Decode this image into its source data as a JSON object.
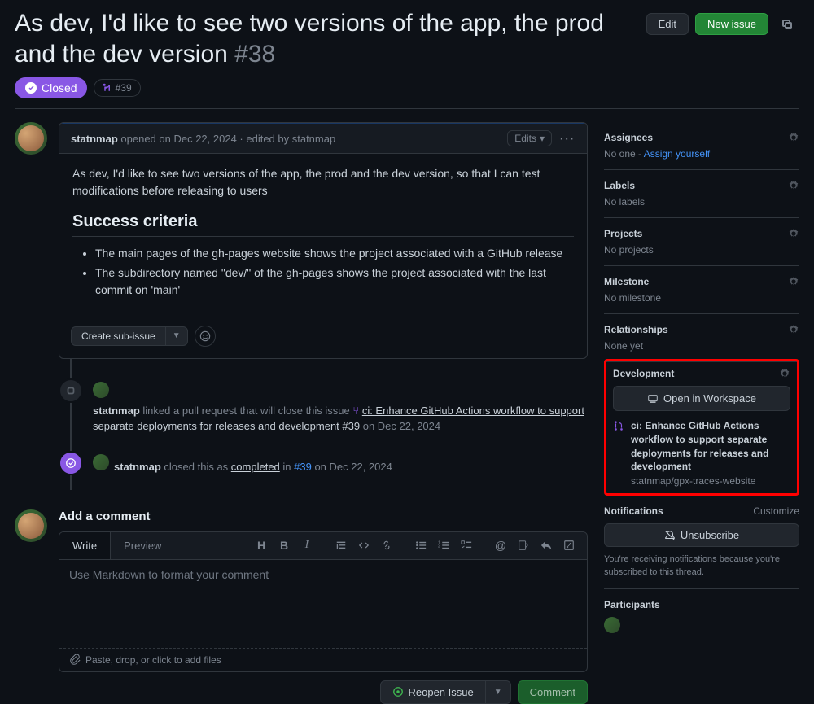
{
  "title": "As dev, I'd like to see two versions of the app, the prod and the dev version",
  "issue_number": "#38",
  "header_buttons": {
    "edit": "Edit",
    "new_issue": "New issue"
  },
  "status": {
    "label": "Closed",
    "linked_pr": "#39"
  },
  "comment": {
    "author": "statnmap",
    "meta": " opened on Dec 22, 2024 · edited by statnmap",
    "edits_label": "Edits",
    "body_text": "As dev, I'd like to see two versions of the app, the prod and the dev version, so that I can test modifications before releasing to users",
    "success_heading": "Success criteria",
    "criteria": [
      "The main pages of the gh-pages website shows the project associated with a GitHub release",
      "The subdirectory named \"dev/\" of the gh-pages shows the project associated with the last commit on 'main'"
    ],
    "sub_issue_btn": "Create sub-issue"
  },
  "timeline": {
    "link_event": {
      "author": "statnmap",
      "action": " linked a pull request that will close this issue ",
      "pr_title": "ci: Enhance GitHub Actions workflow to support separate deployments for releases and development #39",
      "date": " on Dec 22, 2024"
    },
    "close_event": {
      "author": "statnmap",
      "action1": " closed this as ",
      "completed": "completed",
      "action2": " in ",
      "pr_ref": "#39",
      "date": " on Dec 22, 2024"
    }
  },
  "add_comment": {
    "title": "Add a comment",
    "tab_write": "Write",
    "tab_preview": "Preview",
    "placeholder": "Use Markdown to format your comment",
    "drop_hint": "Paste, drop, or click to add files",
    "reopen_btn": "Reopen Issue",
    "comment_btn": "Comment"
  },
  "sidebar": {
    "assignees": {
      "title": "Assignees",
      "empty": "No one - ",
      "assign_self": "Assign yourself"
    },
    "labels": {
      "title": "Labels",
      "empty": "No labels"
    },
    "projects": {
      "title": "Projects",
      "empty": "No projects"
    },
    "milestone": {
      "title": "Milestone",
      "empty": "No milestone"
    },
    "relationships": {
      "title": "Relationships",
      "empty": "None yet"
    },
    "development": {
      "title": "Development",
      "open_workspace": "Open in Workspace",
      "pr_title": "ci: Enhance GitHub Actions workflow to support separate deployments for releases and development",
      "repo": "statnmap/gpx-traces-website"
    },
    "notifications": {
      "title": "Notifications",
      "customize": "Customize",
      "unsubscribe": "Unsubscribe",
      "desc": "You're receiving notifications because you're subscribed to this thread."
    },
    "participants": {
      "title": "Participants"
    }
  }
}
